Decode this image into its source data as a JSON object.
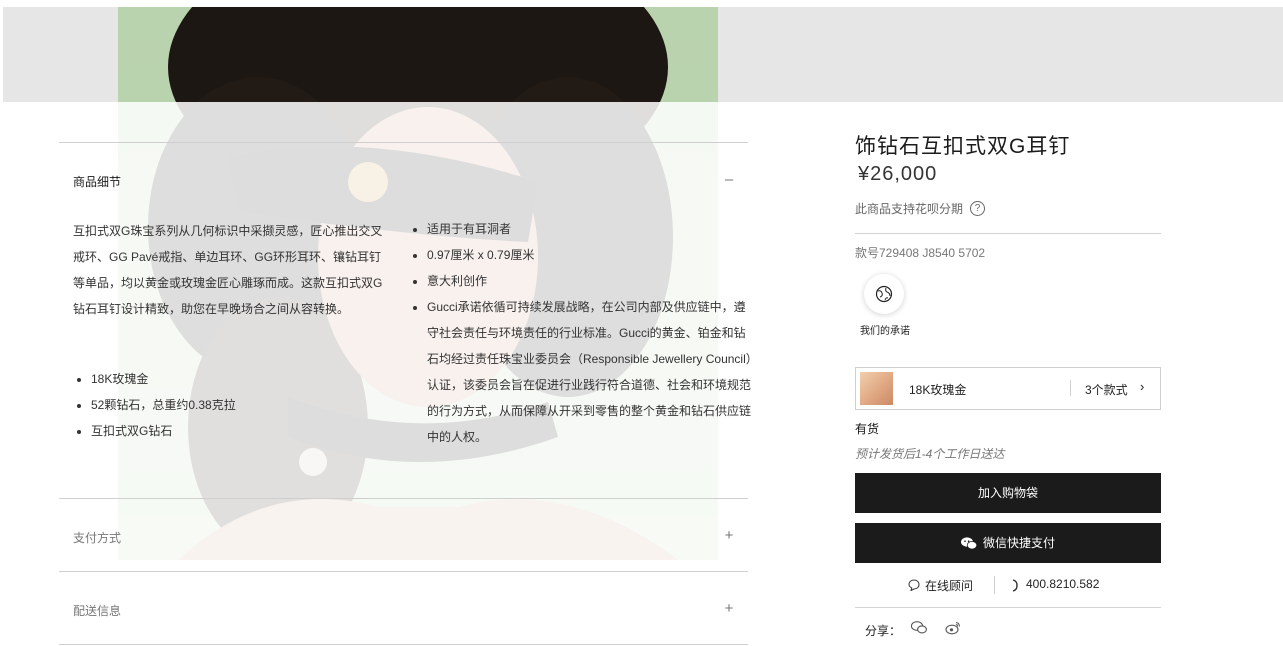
{
  "accordion": {
    "details": {
      "title": "商品细节",
      "toggle": "–",
      "description": "互扣式双G珠宝系列从几何标识中采撷灵感，匠心推出交叉戒环、GG Pavé戒指、单边耳环、GG环形耳环、镶钻耳钉等单品，均以黄金或玫瑰金匠心雕琢而成。这款互扣式双G钻石耳钉设计精致，助您在早晚场合之间从容转换。",
      "left_bullets": [
        "18K玫瑰金",
        "52颗钻石，总重约0.38克拉",
        "互扣式双G钻石"
      ],
      "right_bullets": [
        "适用于有耳洞者",
        "0.97厘米 x 0.79厘米",
        "意大利创作",
        "Gucci承诺依循可持续发展战略，在公司内部及供应链中，遵守社会责任与环境责任的行业标准。Gucci的黄金、铂金和钻石均经过责任珠宝业委员会（Responsible Jewellery Council）认证，该委员会旨在促进行业践行符合道德、社会和环境规范的行为方式，从而保障从开采到零售的整个黄金和钻石供应链中的人权。"
      ]
    },
    "payment": {
      "title": "支付方式",
      "toggle": "+"
    },
    "shipping": {
      "title": "配送信息",
      "toggle": "+"
    }
  },
  "product": {
    "name": "饰钻石互扣式双G耳钉",
    "price": "¥26,000",
    "installment": "此商品支持花呗分期",
    "help_icon": "?",
    "style_no": "款号729408 J8540 5702",
    "promise_label": "我们的承诺",
    "variant": {
      "name": "18K玫瑰金",
      "count": "3个款式",
      "chevron": "›"
    },
    "stock": "有货",
    "delivery": "预计发货后1-4个工作日送达",
    "add_to_bag": "加入购物袋",
    "wechat_pay": "微信快捷支付",
    "online_advisor": "在线顾问",
    "phone": "400.8210.582",
    "share_label": "分享："
  },
  "colors": {
    "button_bg": "#1b1b1b",
    "hero_bg": "#bcd4b2",
    "band": "#e6e6e6"
  }
}
